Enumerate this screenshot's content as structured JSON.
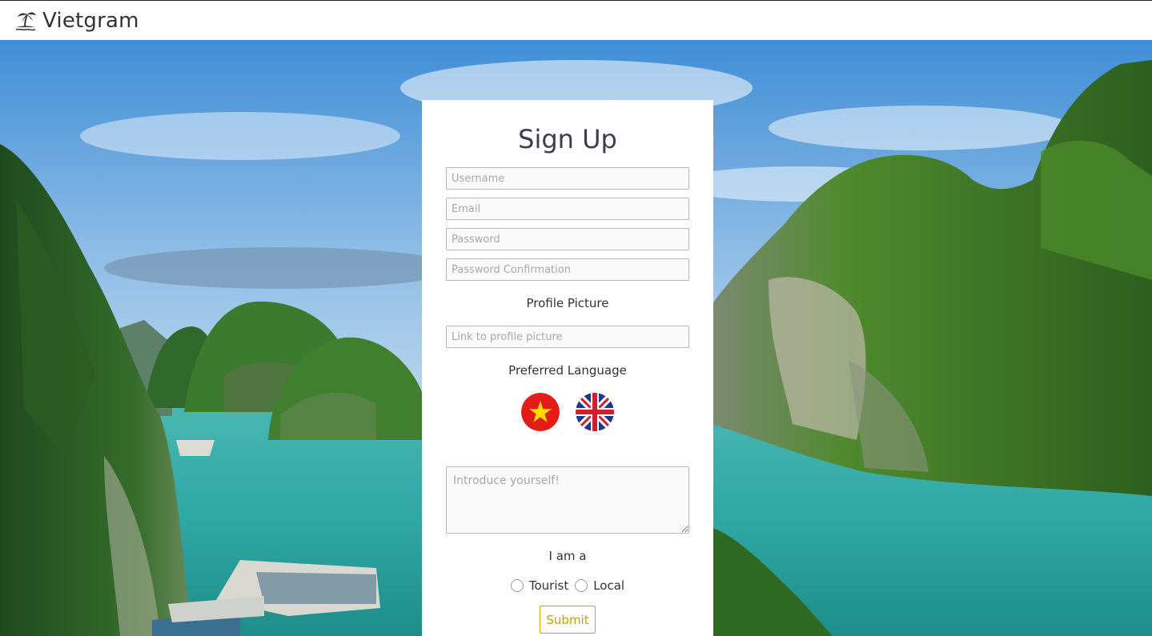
{
  "nav": {
    "brand": "Vietgram",
    "brand_icon": "palm-island-icon"
  },
  "signup": {
    "title": "Sign Up",
    "username_placeholder": "Username",
    "email_placeholder": "Email",
    "password_placeholder": "Password",
    "password_confirmation_placeholder": "Password Confirmation",
    "profile_picture_label": "Profile Picture",
    "profile_picture_placeholder": "Link to profile picture",
    "preferred_language_label": "Preferred Language",
    "languages": [
      {
        "icon": "vietnam-flag-icon"
      },
      {
        "icon": "uk-flag-icon"
      }
    ],
    "bio_placeholder": "Introduce yourself!",
    "role_label": "I am a",
    "roles": [
      "Tourist",
      "Local"
    ],
    "submit_label": "Submit"
  },
  "colors": {
    "submit_accent": "#d4a800",
    "title": "#3a3f4d"
  }
}
